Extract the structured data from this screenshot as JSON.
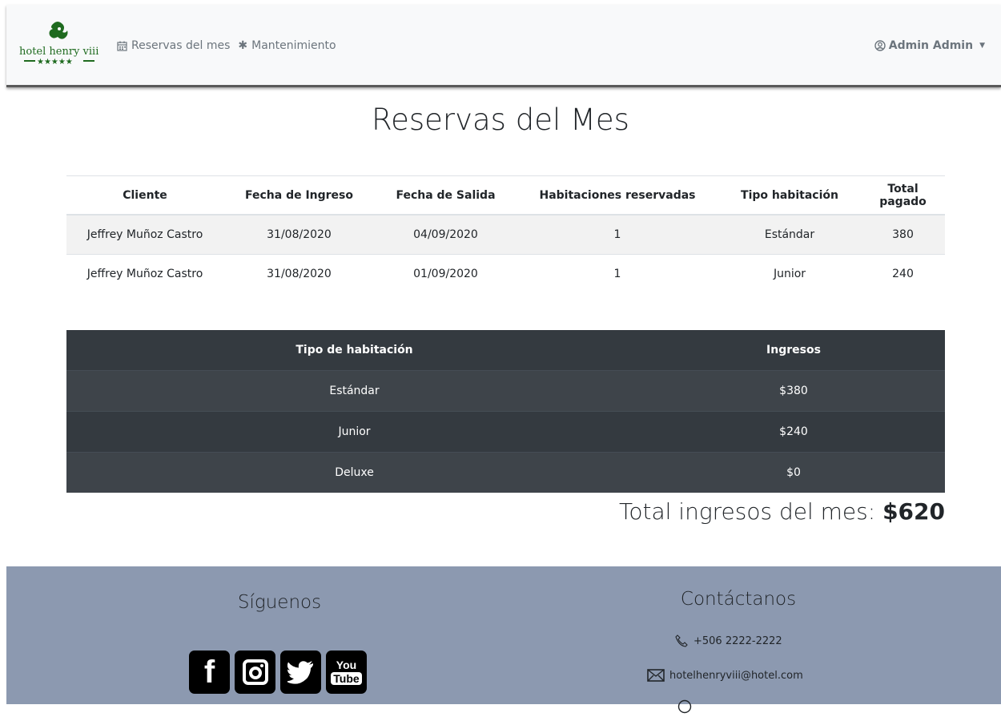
{
  "navbar": {
    "brand_text": "hotel henry viii",
    "brand_stars": "★★★★★",
    "links": [
      {
        "label": "Reservas del mes",
        "icon": "calendar-icon"
      },
      {
        "label": "Mantenimiento",
        "icon": "gear-icon"
      }
    ],
    "user": {
      "label": "Admin Admin",
      "icon": "user-circle-icon"
    }
  },
  "page": {
    "title": "Reservas del Mes"
  },
  "reservations": {
    "headers": [
      "Cliente",
      "Fecha de Ingreso",
      "Fecha de Salida",
      "Habitaciones reservadas",
      "Tipo habitación",
      "Total pagado"
    ],
    "rows": [
      [
        "Jeffrey Muñoz Castro",
        "31/08/2020",
        "04/09/2020",
        "1",
        "Estándar",
        "380"
      ],
      [
        "Jeffrey Muñoz Castro",
        "31/08/2020",
        "01/09/2020",
        "1",
        "Junior",
        "240"
      ]
    ]
  },
  "income": {
    "headers": [
      "Tipo de habitación",
      "Ingresos"
    ],
    "rows": [
      [
        "Estándar",
        "$380"
      ],
      [
        "Junior",
        "$240"
      ],
      [
        "Deluxe",
        "$0"
      ]
    ]
  },
  "total": {
    "label": "Total ingresos del mes: ",
    "value": "$620"
  },
  "footer": {
    "follow_title": "Síguenos",
    "social": [
      {
        "name": "facebook-icon",
        "glyph": "f"
      },
      {
        "name": "instagram-icon",
        "glyph": "◉"
      },
      {
        "name": "twitter-icon",
        "glyph": "🐦"
      },
      {
        "name": "youtube-icon",
        "glyph_top": "You",
        "glyph_bottom": "Tube"
      }
    ],
    "contact_title": "Contáctanos",
    "phone": "+506 2222-2222",
    "email": "hotelhenryviii@hotel.com"
  },
  "colors": {
    "navbar_bg": "#f8f9fa",
    "footer_bg": "#8c99b0",
    "dark_table": "#343a40",
    "brand_green": "#1f6b1f"
  }
}
